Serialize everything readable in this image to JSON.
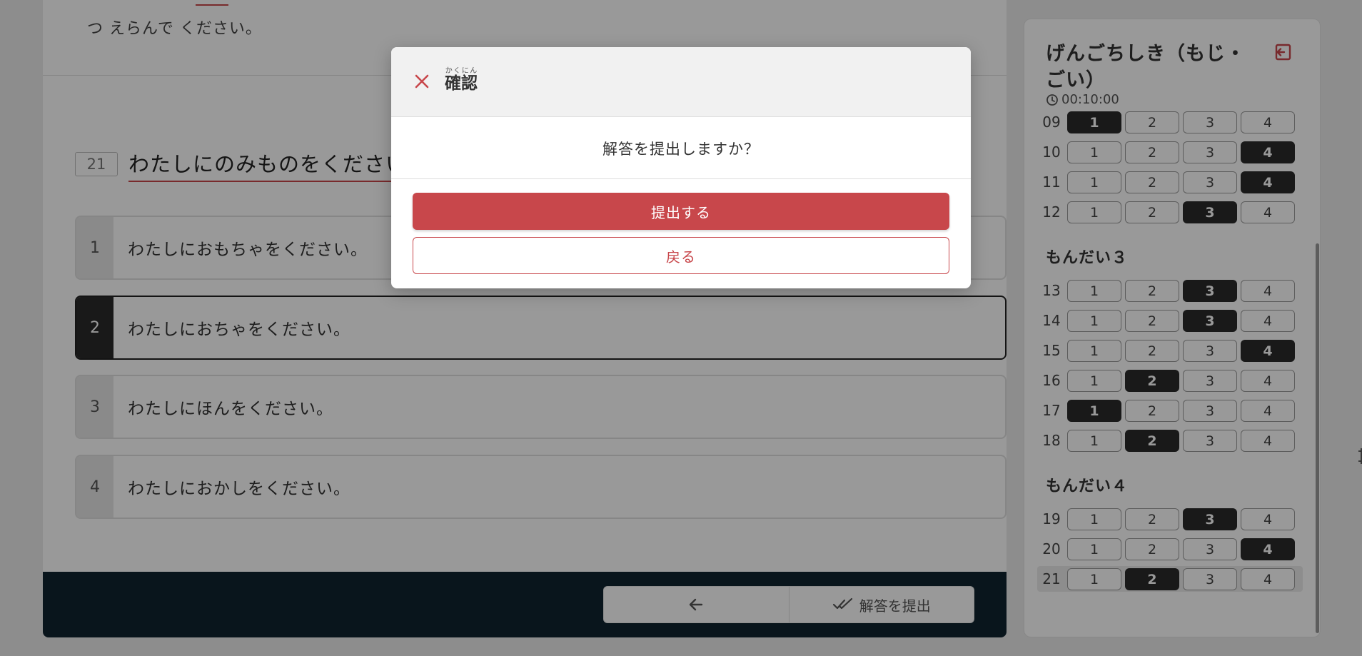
{
  "instruction": {
    "text": "つ えらんで ください。"
  },
  "question": {
    "number": "21",
    "text": "わたしにのみものをください。"
  },
  "options": [
    {
      "num": "1",
      "text": "わたしにおもちゃをください。",
      "selected": false
    },
    {
      "num": "2",
      "text": "わたしにおちゃをください。",
      "selected": true
    },
    {
      "num": "3",
      "text": "わたしにほんをください。",
      "selected": false
    },
    {
      "num": "4",
      "text": "わたしにおかしをください。",
      "selected": false
    }
  ],
  "footer": {
    "prev_icon": "arrow-left-icon",
    "submit_label": "解答を提出",
    "submit_icon": "double-check-icon"
  },
  "sidebar": {
    "title": "げんごちしき（もじ・ごい）",
    "timer": "00:10:00",
    "timer_icon": "clock-icon",
    "exit_icon": "exit-icon",
    "option_labels": [
      "1",
      "2",
      "3",
      "4"
    ],
    "groups": [
      {
        "heading": "",
        "rows": [
          {
            "num": "09",
            "selected": 1
          },
          {
            "num": "10",
            "selected": 4
          },
          {
            "num": "11",
            "selected": 4
          },
          {
            "num": "12",
            "selected": 3
          }
        ]
      },
      {
        "heading": "もんだい３",
        "rows": [
          {
            "num": "13",
            "selected": 3
          },
          {
            "num": "14",
            "selected": 3
          },
          {
            "num": "15",
            "selected": 4
          },
          {
            "num": "16",
            "selected": 2
          },
          {
            "num": "17",
            "selected": 1
          },
          {
            "num": "18",
            "selected": 2
          }
        ]
      },
      {
        "heading": "もんだい４",
        "rows": [
          {
            "num": "19",
            "selected": 3
          },
          {
            "num": "20",
            "selected": 4
          },
          {
            "num": "21",
            "selected": 2,
            "active": true
          }
        ]
      }
    ]
  },
  "modal": {
    "close_icon": "close-icon",
    "title": "確認",
    "title_ruby": "かくにん",
    "message": "解答を提出しますか？",
    "submit_label": "提出する",
    "back_label": "戻る"
  },
  "colors": {
    "accent": "#c8474b",
    "footer_bg": "#102330",
    "selected": "#2b2b2b"
  }
}
